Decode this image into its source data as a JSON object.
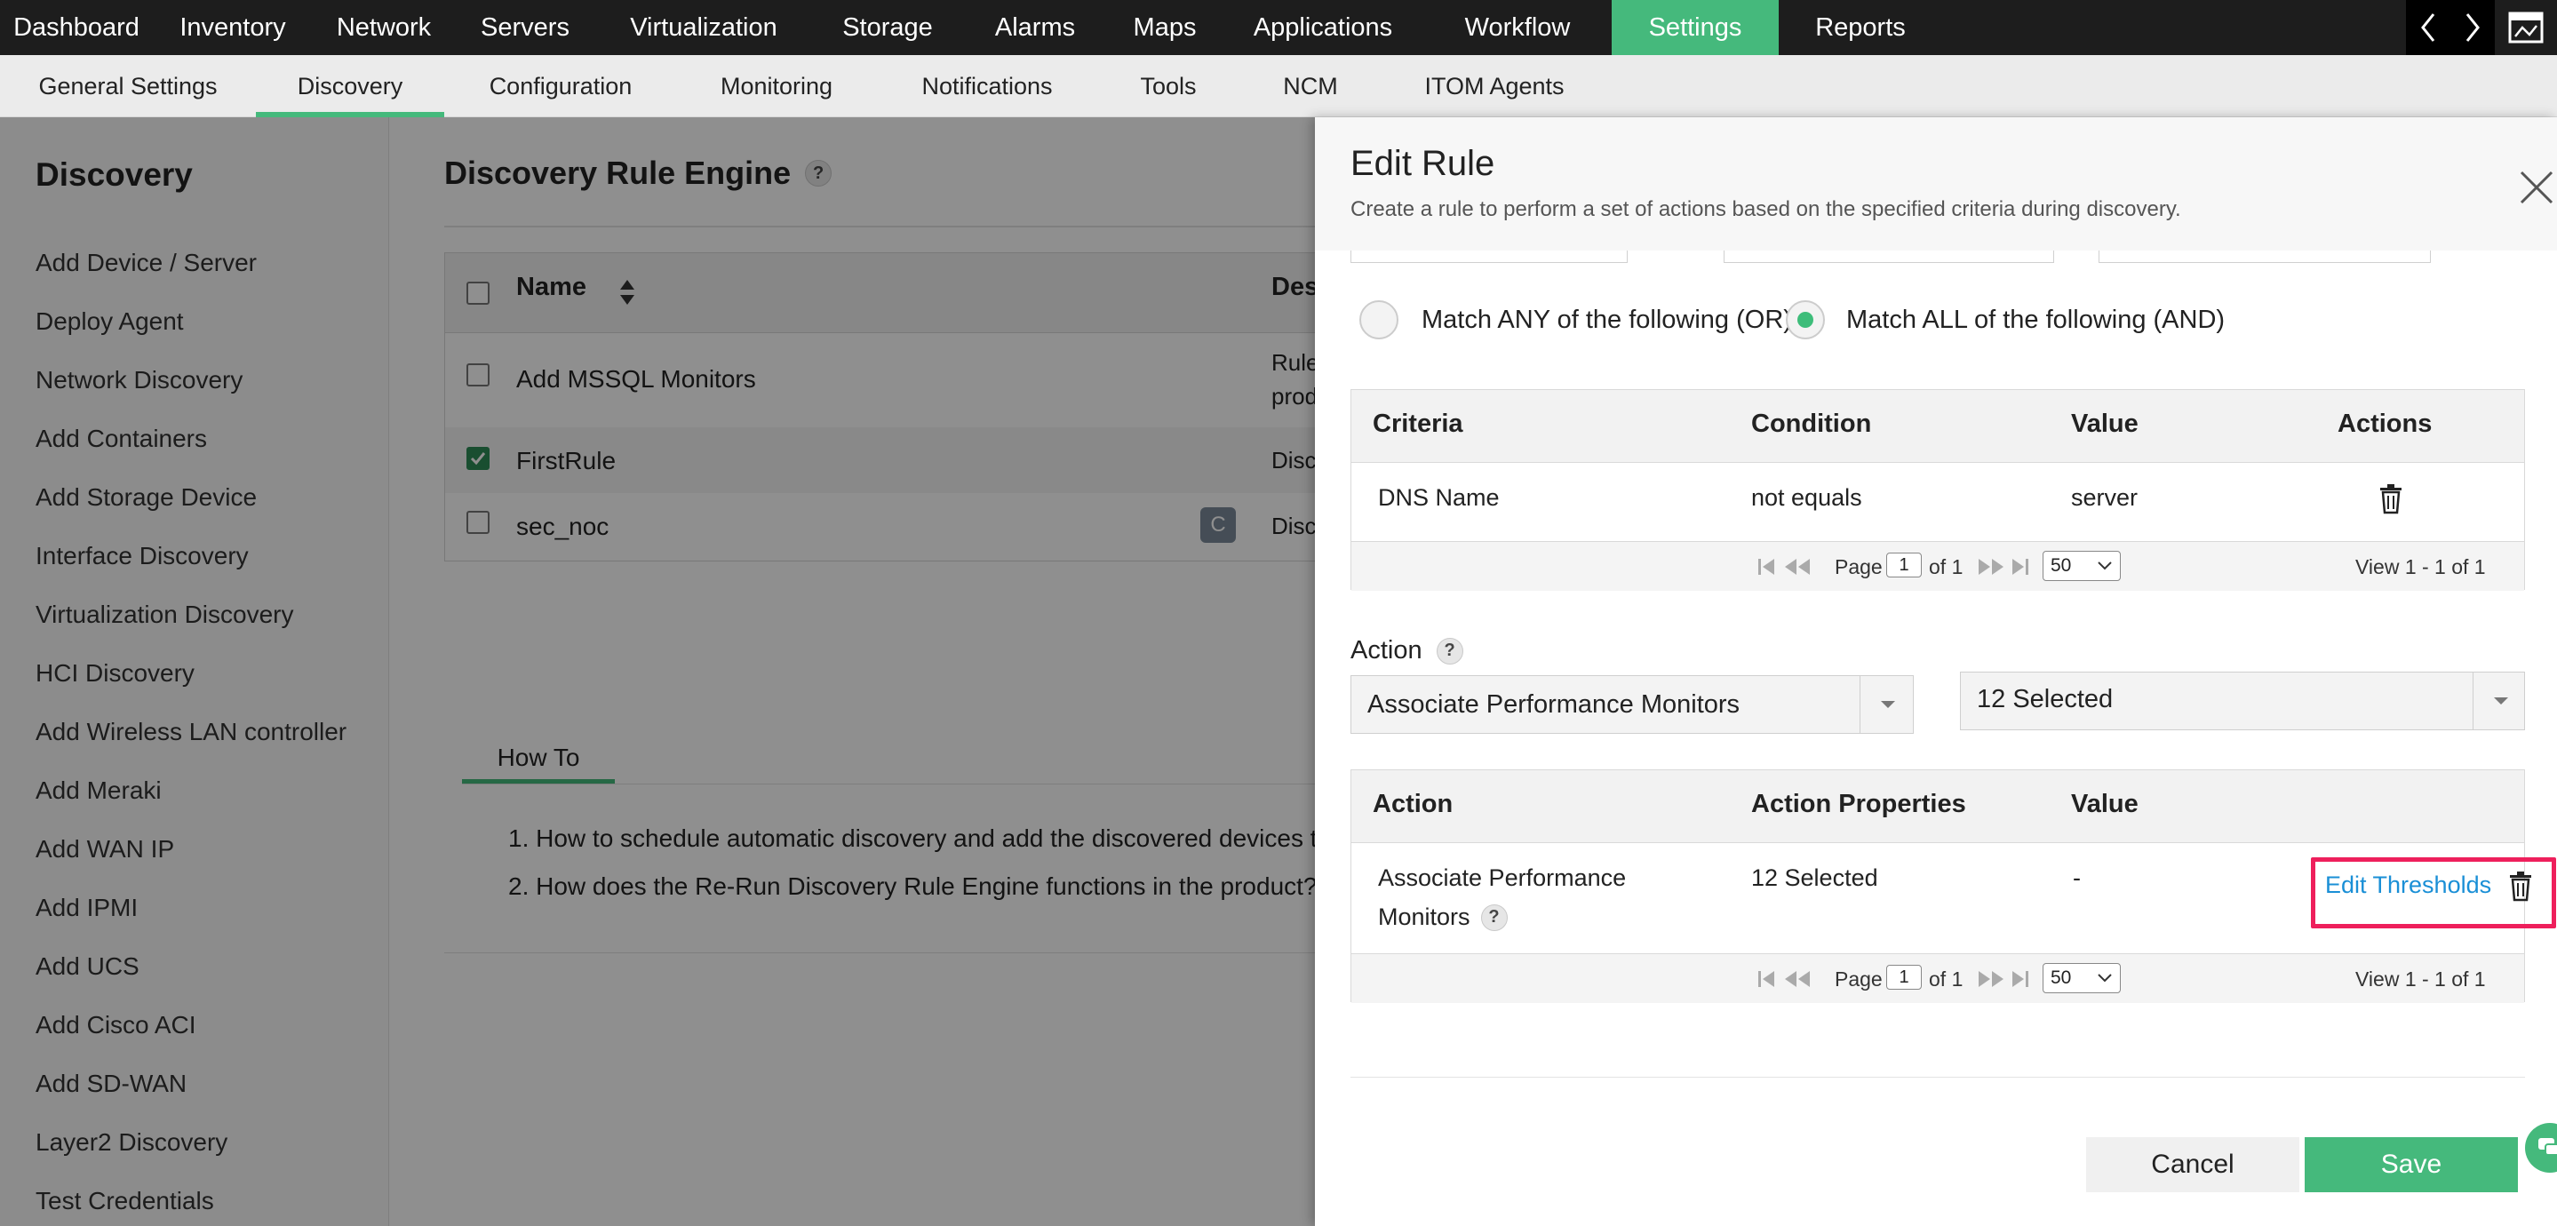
{
  "topnav": {
    "items": [
      "Dashboard",
      "Inventory",
      "Network",
      "Servers",
      "Virtualization",
      "Storage",
      "Alarms",
      "Maps",
      "Applications",
      "Workflow",
      "Settings",
      "Reports"
    ],
    "active": "Settings",
    "accent": "#45b97c"
  },
  "subnav": {
    "items": [
      "General Settings",
      "Discovery",
      "Configuration",
      "Monitoring",
      "Notifications",
      "Tools",
      "NCM",
      "ITOM Agents"
    ],
    "active": "Discovery"
  },
  "sidebar": {
    "title": "Discovery",
    "items": [
      "Add Device / Server",
      "Deploy Agent",
      "Network Discovery",
      "Add Containers",
      "Add Storage Device",
      "Interface Discovery",
      "Virtualization Discovery",
      "HCI Discovery",
      "Add Wireless LAN controller",
      "Add Meraki",
      "Add WAN IP",
      "Add IPMI",
      "Add UCS",
      "Add Cisco ACI",
      "Add SD-WAN",
      "Layer2 Discovery",
      "Test Credentials"
    ]
  },
  "main": {
    "title": "Discovery Rule Engine",
    "help": "?",
    "table": {
      "col_name": "Name",
      "col_desc": "Des",
      "rows": [
        {
          "name": "Add MSSQL Monitors",
          "desc_line1": "Rule",
          "desc_line2": "prod",
          "checked": false
        },
        {
          "name": "FirstRule",
          "desc_line1": "Disc",
          "checked": true
        },
        {
          "name": "sec_noc",
          "desc_line1": "Disc",
          "badge": "C",
          "checked": false
        }
      ]
    },
    "howto": {
      "tab": "How To",
      "items": [
        "1. How to schedule automatic discovery and add the discovered devices to t",
        "2. How does the Re-Run Discovery Rule Engine functions in the product?"
      ]
    }
  },
  "panel": {
    "title": "Edit Rule",
    "subtitle": "Create a rule to perform a set of actions based on the specified criteria during discovery.",
    "match_any": "Match ANY of the following (OR)",
    "match_all": "Match ALL of the following (AND)",
    "match_selected": "all",
    "criteria": {
      "headers": [
        "Criteria",
        "Condition",
        "Value",
        "Actions"
      ],
      "rows": [
        {
          "criteria": "DNS Name",
          "condition": "not equals",
          "value": "server"
        }
      ],
      "pager": {
        "page_label": "Page",
        "page": "1",
        "of": "of 1",
        "per_page": "50",
        "view": "View 1 - 1 of 1"
      }
    },
    "action": {
      "label": "Action",
      "help": "?",
      "type_value": "Associate Performance Monitors",
      "selection_value": "12 Selected"
    },
    "actions_table": {
      "headers": [
        "Action",
        "Action Properties",
        "Value"
      ],
      "rows": [
        {
          "action_line1": "Associate Performance",
          "action_line2": "Monitors",
          "help": "?",
          "properties": "12 Selected",
          "value": "-",
          "link": "Edit Thresholds"
        }
      ],
      "pager": {
        "page_label": "Page",
        "page": "1",
        "of": "of 1",
        "per_page": "50",
        "view": "View 1 - 1 of 1"
      }
    },
    "cancel": "Cancel",
    "save": "Save",
    "highlight_color": "#ee1f5c",
    "link_color": "#1a8fd6"
  }
}
